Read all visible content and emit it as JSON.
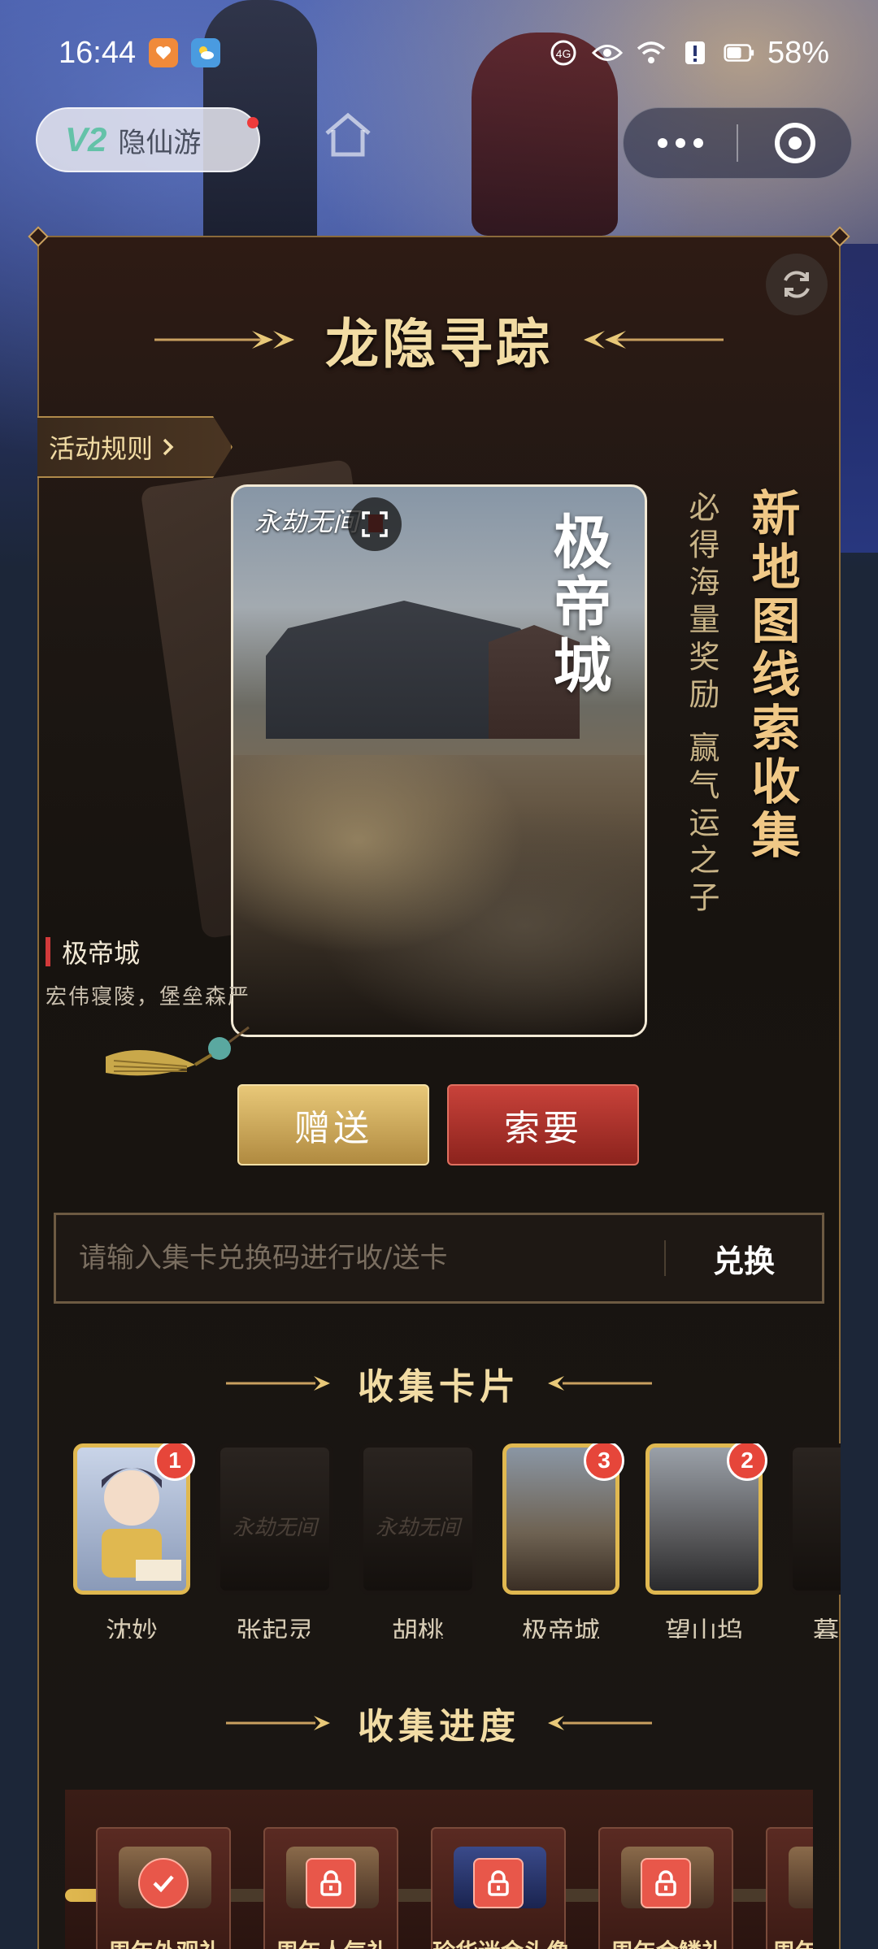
{
  "status_bar": {
    "time": "16:44",
    "battery": "58%"
  },
  "mini_program": {
    "badge": "V2",
    "name": "隐仙游"
  },
  "header": {
    "title": "龙隐寻踪",
    "rules_label": "活动规则"
  },
  "feature_card": {
    "brand": "永劫无间",
    "vertical_title": "极帝城",
    "name": "极帝城",
    "subtitle": "宏伟寝陵，堡垒森严"
  },
  "promo": {
    "line_small": "必得海量奖励 赢气运之子",
    "line_big": "新地图线索收集"
  },
  "actions": {
    "give_label": "赠送",
    "ask_label": "索要"
  },
  "redeem": {
    "placeholder": "请输入集卡兑换码进行收/送卡",
    "button_label": "兑换"
  },
  "collect_section": {
    "title": "收集卡片",
    "cards": [
      {
        "label": "沈妙",
        "count": "1",
        "owned": true
      },
      {
        "label": "张起灵",
        "owned": false
      },
      {
        "label": "胡桃",
        "owned": false
      },
      {
        "label": "极帝城",
        "count": "3",
        "owned": true
      },
      {
        "label": "望山坞",
        "count": "2",
        "owned": true
      },
      {
        "label": "暮",
        "owned": false
      }
    ],
    "card_logo": "永劫无间"
  },
  "progress_section": {
    "title": "收集进度",
    "progress_fraction": 0.2,
    "rewards": [
      {
        "label": "周年外观礼",
        "state": "claimed"
      },
      {
        "label": "周年人气礼",
        "state": "locked"
      },
      {
        "label": "珍华迷金头像",
        "state": "locked"
      },
      {
        "label": "周年金鳞礼",
        "state": "locked"
      },
      {
        "label": "周年",
        "state": "locked"
      }
    ]
  },
  "colors": {
    "accent_gold": "#f2dca4",
    "give_gold": "#d4b060",
    "ask_red": "#b0322a",
    "badge_red": "#e6463a"
  }
}
